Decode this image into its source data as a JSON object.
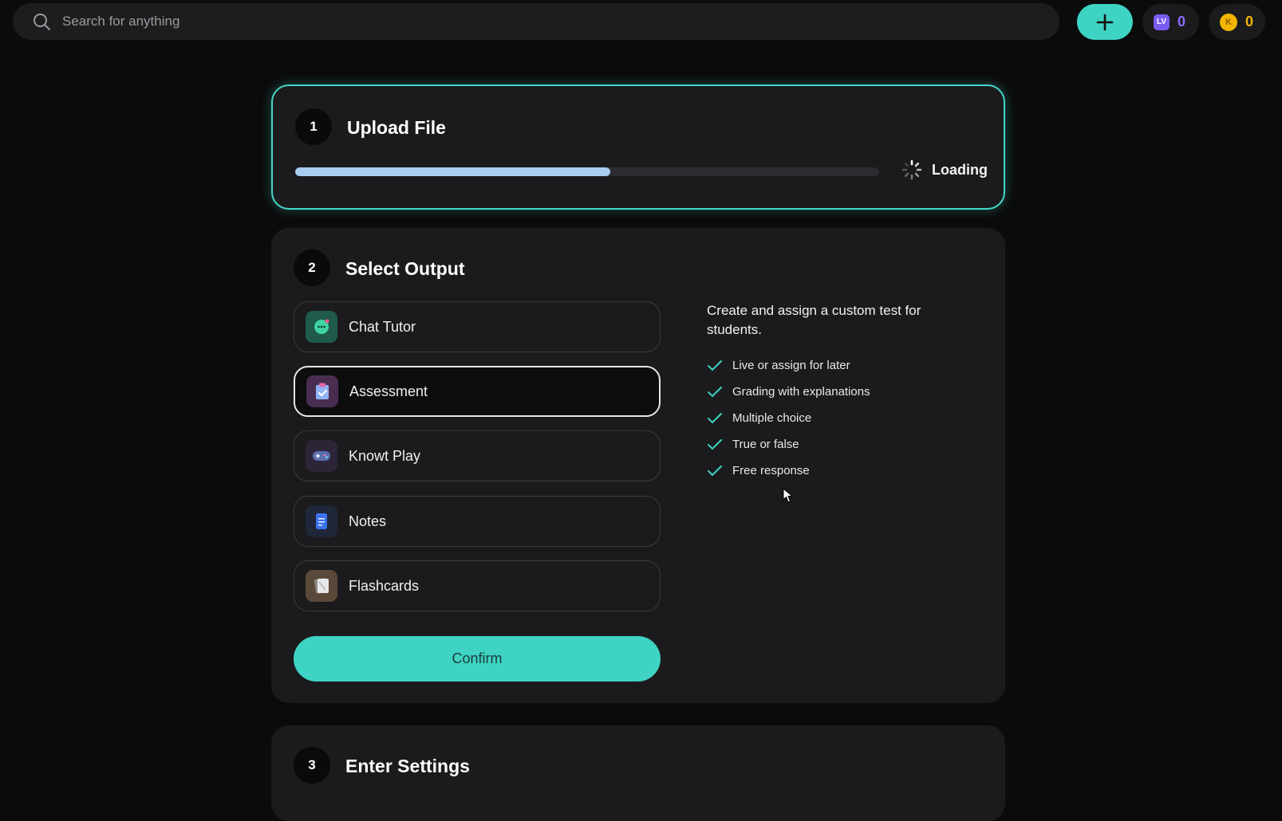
{
  "search": {
    "placeholder": "Search for anything"
  },
  "header": {
    "level_count": "0",
    "coin_count": "0",
    "level_badge": "LV",
    "coin_badge": "K"
  },
  "steps": {
    "upload": {
      "number": "1",
      "title": "Upload File",
      "progress_fraction": 0.54,
      "status": "Loading"
    },
    "output": {
      "number": "2",
      "title": "Select Output",
      "options": [
        {
          "label": "Chat Tutor",
          "icon": "chat-bubble-icon"
        },
        {
          "label": "Assessment",
          "icon": "clipboard-icon",
          "selected": true
        },
        {
          "label": "Knowt Play",
          "icon": "gamepad-icon"
        },
        {
          "label": "Notes",
          "icon": "document-icon"
        },
        {
          "label": "Flashcards",
          "icon": "flashcards-icon"
        }
      ],
      "confirm_label": "Confirm",
      "description": "Create and assign a custom test for students.",
      "features": [
        "Live or assign for later",
        "Grading with explanations",
        "Multiple choice",
        "True or false",
        "Free response"
      ]
    },
    "settings": {
      "number": "3",
      "title": "Enter Settings"
    }
  },
  "colors": {
    "accent": "#3ed3c3",
    "progress": "#a8ccf0",
    "background": "#0b0b0c",
    "card": "#1b1b1d"
  }
}
